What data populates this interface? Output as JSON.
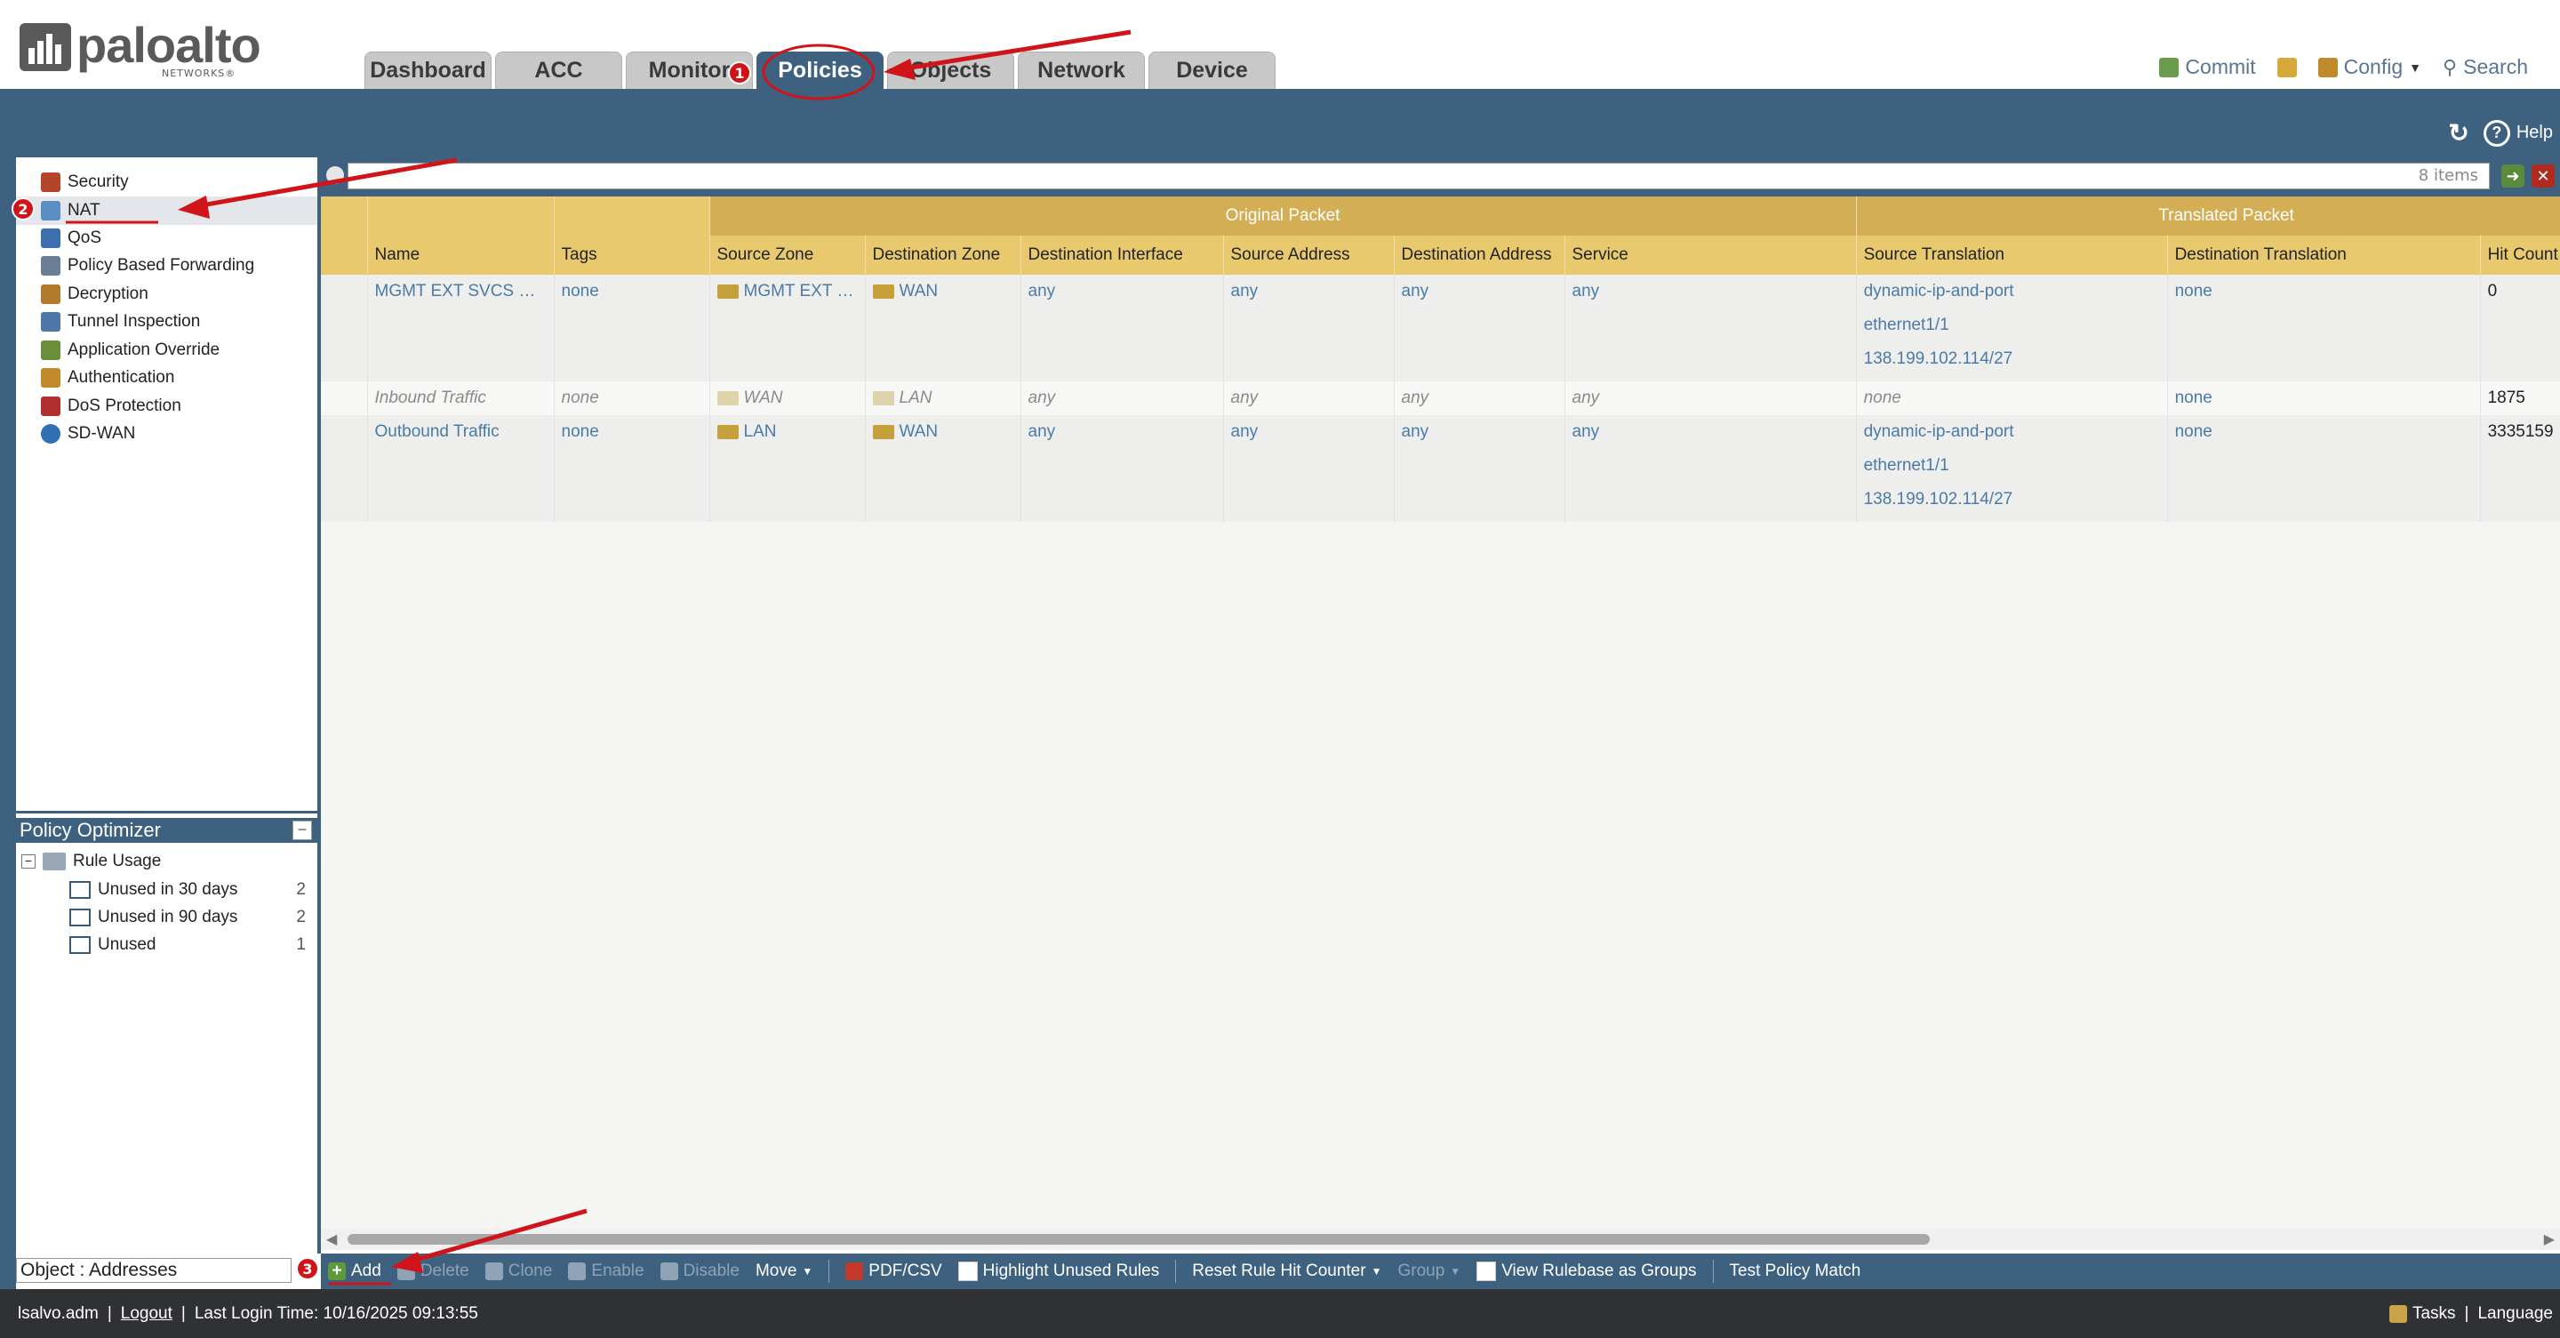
{
  "header": {
    "brand": "paloalto",
    "brand_sub": "NETWORKS®",
    "tabs": [
      {
        "label": "Dashboard"
      },
      {
        "label": "ACC"
      },
      {
        "label": "Monitor"
      },
      {
        "label": "Policies",
        "active": true
      },
      {
        "label": "Objects"
      },
      {
        "label": "Network"
      },
      {
        "label": "Device"
      }
    ],
    "links": {
      "commit": "Commit",
      "config": "Config",
      "search": "Search"
    }
  },
  "band": {
    "help": "Help"
  },
  "nav": {
    "items": [
      {
        "label": "Security",
        "icon": "security-icon",
        "color": "#b5452a"
      },
      {
        "label": "NAT",
        "icon": "nat-icon",
        "color": "#5b8fc4",
        "selected": true
      },
      {
        "label": "QoS",
        "icon": "qos-icon",
        "color": "#3c6fb0"
      },
      {
        "label": "Policy Based Forwarding",
        "icon": "pbf-icon",
        "color": "#6a7f96"
      },
      {
        "label": "Decryption",
        "icon": "decryption-icon",
        "color": "#b07b2a"
      },
      {
        "label": "Tunnel Inspection",
        "icon": "tunnel-inspection-icon",
        "color": "#4d77a8"
      },
      {
        "label": "Application Override",
        "icon": "application-override-icon",
        "color": "#6a8f3c"
      },
      {
        "label": "Authentication",
        "icon": "authentication-icon",
        "color": "#c08a2a"
      },
      {
        "label": "DoS Protection",
        "icon": "dos-protection-icon",
        "color": "#b03030"
      },
      {
        "label": "SD-WAN",
        "icon": "sd-wan-icon",
        "color": "#2f6fb5"
      }
    ]
  },
  "optimizer": {
    "title": "Policy Optimizer",
    "group": "Rule Usage",
    "rows": [
      {
        "label": "Unused in 30 days",
        "count": "2"
      },
      {
        "label": "Unused in 90 days",
        "count": "2"
      },
      {
        "label": "Unused",
        "count": "1"
      }
    ]
  },
  "object_field": {
    "value": "Object : Addresses"
  },
  "search": {
    "count": "8 items"
  },
  "table": {
    "groups": {
      "original": "Original Packet",
      "translated": "Translated Packet"
    },
    "columns": [
      "Name",
      "Tags",
      "Source Zone",
      "Destination Zone",
      "Destination Interface",
      "Source Address",
      "Destination Address",
      "Service",
      "Source Translation",
      "Destination Translation",
      "Hit Count"
    ],
    "rows": [
      {
        "name": "MGMT EXT SVCS NAT",
        "tags": "none",
        "src_zone": "MGMT EXT S...",
        "dst_zone": "WAN",
        "dst_if": "any",
        "src_addr": "any",
        "dst_addr": "any",
        "service": "any",
        "src_trans": [
          "dynamic-ip-and-port",
          "ethernet1/1",
          "138.199.102.114/27"
        ],
        "dst_trans": "none",
        "hits": "0",
        "disabled": false
      },
      {
        "name": "Inbound Traffic",
        "tags": "none",
        "src_zone": "WAN",
        "dst_zone": "LAN",
        "dst_if": "any",
        "src_addr": "any",
        "dst_addr": "any",
        "service": "any",
        "src_trans": [
          "none"
        ],
        "dst_trans": "none",
        "hits": "1875",
        "disabled": true
      },
      {
        "name": "Outbound Traffic",
        "tags": "none",
        "src_zone": "LAN",
        "dst_zone": "WAN",
        "dst_if": "any",
        "src_addr": "any",
        "dst_addr": "any",
        "service": "any",
        "src_trans": [
          "dynamic-ip-and-port",
          "ethernet1/1",
          "138.199.102.114/27"
        ],
        "dst_trans": "none",
        "hits": "3335159",
        "disabled": false
      }
    ]
  },
  "toolbar": {
    "add": "Add",
    "delete": "Delete",
    "clone": "Clone",
    "enable": "Enable",
    "disable": "Disable",
    "move": "Move",
    "pdf_csv": "PDF/CSV",
    "highlight_unused": "Highlight Unused Rules",
    "reset_hit": "Reset Rule Hit Counter",
    "group": "Group",
    "view_groups": "View Rulebase as Groups",
    "test_match": "Test Policy Match"
  },
  "status": {
    "user": "lsalvo.adm",
    "logout": "Logout",
    "last_login": "Last Login Time: 10/16/2025 09:13:55",
    "tasks": "Tasks",
    "language": "Language"
  },
  "annotations": {
    "markers": [
      "1",
      "2",
      "3"
    ],
    "color": "#d0141a"
  }
}
